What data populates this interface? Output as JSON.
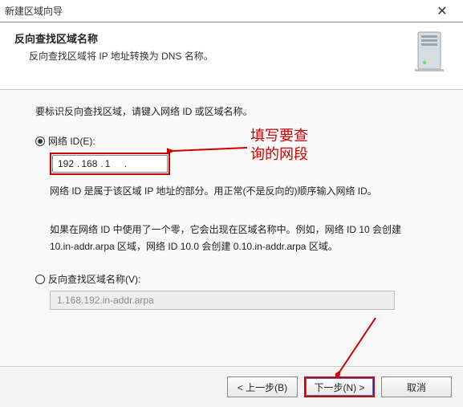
{
  "window": {
    "title": "新建区域向导"
  },
  "header": {
    "title": "反向查找区域名称",
    "desc": "反向查找区域将 IP 地址转换为 DNS 名称。"
  },
  "content": {
    "instruction": "要标识反向查找区域，请键入网络 ID 或区域名称。",
    "radio_network_label": "网络 ID(E):",
    "ip": {
      "o1": "192",
      "o2": "168",
      "o3": "1",
      "o4": ""
    },
    "network_desc": "网络 ID 是属于该区域 IP 地址的部分。用正常(不是反向的)顺序输入网络 ID。",
    "zero_desc": "如果在网络 ID 中使用了一个零，它会出现在区域名称中。例如，网络 ID 10 会创建 10.in-addr.arpa 区域，网络 ID 10.0 会创建 0.10.in-addr.arpa 区域。",
    "radio_zone_label": "反向查找区域名称(V):",
    "zone_value": "1.168.192.in-addr.arpa"
  },
  "buttons": {
    "back": "< 上一步(B)",
    "next": "下一步(N) >",
    "cancel": "取消"
  },
  "annotation": {
    "text1": "填写要查",
    "text2": "询的网段"
  }
}
